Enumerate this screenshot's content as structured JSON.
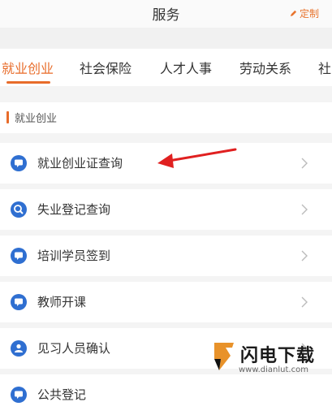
{
  "header": {
    "title": "服务",
    "customize_label": "定制"
  },
  "tabs": [
    {
      "label": "就业创业",
      "active": true
    },
    {
      "label": "社会保险",
      "active": false
    },
    {
      "label": "人才人事",
      "active": false
    },
    {
      "label": "劳动关系",
      "active": false
    },
    {
      "label": "社",
      "active": false
    }
  ],
  "section": {
    "title": "就业创业"
  },
  "services": [
    {
      "label": "就业创业证查询",
      "icon": "message-icon"
    },
    {
      "label": "失业登记查询",
      "icon": "search-badge-icon"
    },
    {
      "label": "培训学员签到",
      "icon": "message-icon"
    },
    {
      "label": "教师开课",
      "icon": "message-icon"
    },
    {
      "label": "见习人员确认",
      "icon": "person-icon"
    },
    {
      "label": "公共登记",
      "icon": "message-icon"
    }
  ],
  "watermark": {
    "title": "闪电下载",
    "url": "www.dianlut.com"
  },
  "colors": {
    "accent": "#e86c2a",
    "icon_blue": "#2f6fd1",
    "arrow_red": "#e02020"
  }
}
